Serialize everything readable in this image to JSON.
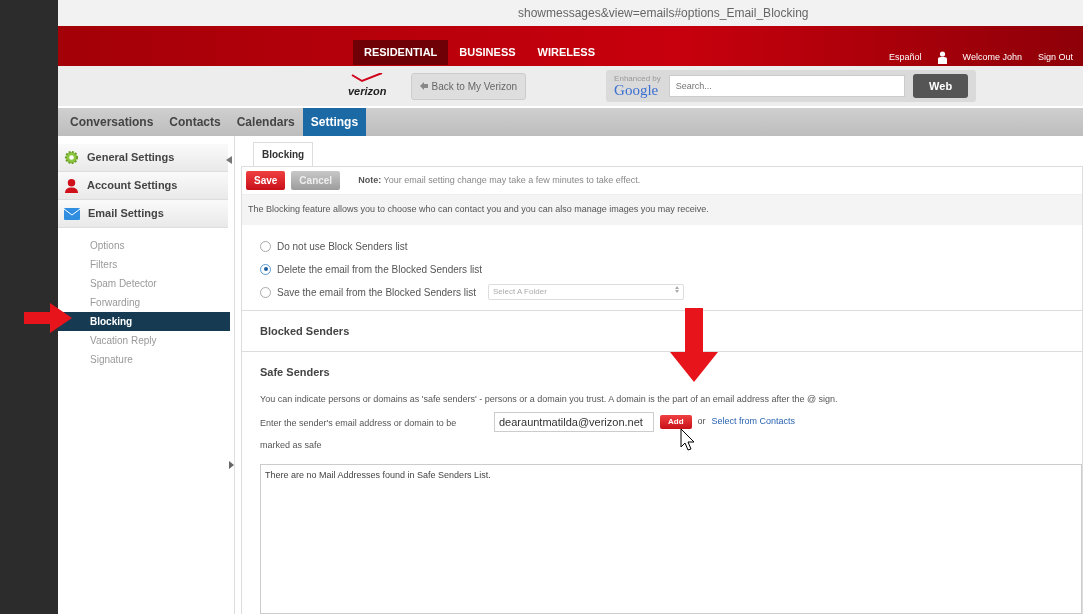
{
  "address_bar": {
    "url": "showmessages&view=emails#options_Email_Blocking"
  },
  "top_nav": [
    {
      "label": "RESIDENTIAL",
      "selected": true
    },
    {
      "label": "BUSINESS",
      "selected": false
    },
    {
      "label": "WIRELESS",
      "selected": false
    }
  ],
  "user_links": {
    "language": "Español",
    "welcome": "Welcome  John",
    "sign_out": "Sign Out"
  },
  "header": {
    "logo": "verizon",
    "back_button": "Back to My Verizon",
    "enhanced_by": "Enhanced by",
    "google": "Google",
    "search": {
      "placeholder": "Search..."
    },
    "search_button": "Web"
  },
  "app_tabs": [
    {
      "label": "Conversations",
      "selected": false
    },
    {
      "label": "Contacts",
      "selected": false
    },
    {
      "label": "Calendars",
      "selected": false
    },
    {
      "label": "Settings",
      "selected": true
    }
  ],
  "sidebar": {
    "sections": [
      {
        "label": "General Settings",
        "kind": "gear"
      },
      {
        "label": "Account Settings",
        "kind": "person"
      },
      {
        "label": "Email Settings",
        "kind": "envelope"
      }
    ],
    "items": [
      {
        "label": "Options",
        "selected": false
      },
      {
        "label": "Filters",
        "selected": false
      },
      {
        "label": "Spam Detector",
        "selected": false
      },
      {
        "label": "Forwarding",
        "selected": false
      },
      {
        "label": "Blocking",
        "selected": true
      },
      {
        "label": "Vacation Reply",
        "selected": false
      },
      {
        "label": "Signature",
        "selected": false
      }
    ]
  },
  "panel": {
    "tab": "Blocking",
    "save_button": "Save",
    "cancel_button": "Cancel",
    "note": "**Note:** Your email setting change may take a few minutes to take effect.",
    "intro": "The Blocking feature allows you to choose who can contact you and you can also manage images you may receive.",
    "options": [
      {
        "label": "Do not use Block Senders list",
        "selected": false
      },
      {
        "label": "Delete the email from the Blocked Senders list",
        "selected": true
      },
      {
        "label": "Save the email from the Blocked Senders list",
        "selected": false
      }
    ],
    "folder_select": {
      "placeholder": "Select A Folder"
    },
    "blocked_heading": "Blocked Senders",
    "safe_heading": "Safe Senders",
    "safe_desc": "You can indicate persons or domains as 'safe senders' - persons or a domain you trust. A domain is the part of an email address after the @ sign.",
    "email_label": "Enter the sender's email address or domain to be marked as safe",
    "email_value": "dearauntmatilda@verizon.net",
    "add_button": "Add",
    "or_text": "or",
    "contacts_link": "Select from Contacts",
    "empty_list": "There are no Mail Addresses found in Safe Senders List."
  }
}
